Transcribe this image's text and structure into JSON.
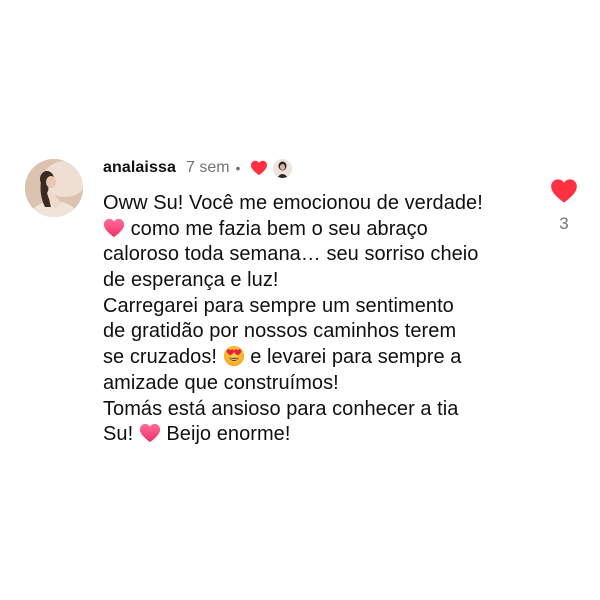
{
  "comment": {
    "username": "analaissa",
    "time": "7 sem",
    "separator": "•",
    "creator_liked_icon": "heart-icon",
    "lines": [
      {
        "pre_icon": null,
        "text": "Oww Su! Você me emocionou de verdade!",
        "emoji": null,
        "after": ""
      },
      {
        "pre_icon": "pink-heart-emoji",
        "text": " como me fazia bem o seu abraço",
        "emoji": null,
        "after": ""
      },
      {
        "pre_icon": null,
        "text": "caloroso toda semana… seu sorriso cheio",
        "emoji": null,
        "after": ""
      },
      {
        "pre_icon": null,
        "text": "de esperança e luz!",
        "emoji": null,
        "after": ""
      },
      {
        "pre_icon": null,
        "text": "Carregarei para sempre um sentimento",
        "emoji": null,
        "after": ""
      },
      {
        "pre_icon": null,
        "text": "de gratidão por nossos caminhos terem",
        "emoji": null,
        "after": ""
      },
      {
        "pre_icon": null,
        "text": "se cruzados! ",
        "emoji": "heart-eyes-emoji",
        "after": " e levarei para sempre a"
      },
      {
        "pre_icon": null,
        "text": "amizade que construímos!",
        "emoji": null,
        "after": ""
      },
      {
        "pre_icon": null,
        "text": "Tomás está ansioso para conhecer a tia",
        "emoji": null,
        "after": ""
      },
      {
        "pre_icon": null,
        "text": "Su! ",
        "emoji": "pink-heart-emoji",
        "after": " Beijo enorme!"
      }
    ]
  },
  "like": {
    "icon": "heart-icon",
    "liked": true,
    "count": "3"
  },
  "colors": {
    "heart_red": "#ff3040",
    "pink_heart": "#f7497d",
    "secondary_text": "#737373",
    "text": "#101010"
  }
}
